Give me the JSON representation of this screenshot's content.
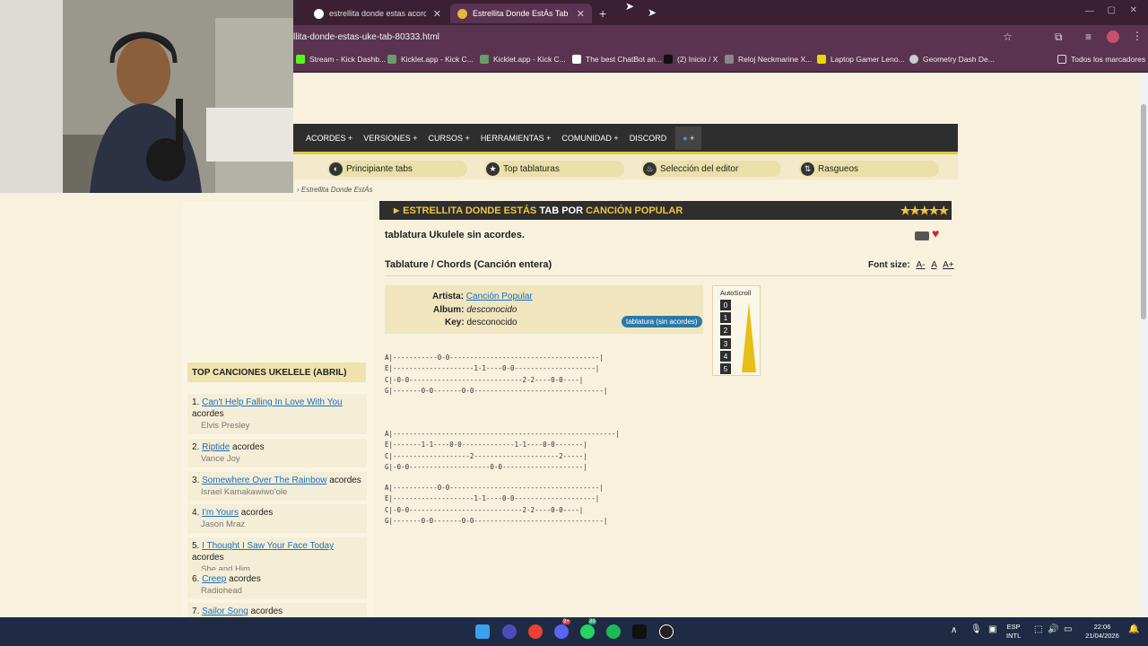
{
  "browser": {
    "tabs": [
      {
        "title": "estrellita donde estas acordes u",
        "active": false
      },
      {
        "title": "Estrellita Donde EstÁs Tab por C",
        "active": true
      }
    ],
    "new_tab": "+",
    "url": "llita-donde-estas-uke-tab-80333.html",
    "bookmarks": [
      "Stream - Kick Dashb...",
      "Kicklet.app - Kick C...",
      "Kicklet.app - Kick C...",
      "The best ChatBot an...",
      "(2) Inicio / X",
      "Reloj Neckmarine X...",
      "Laptop Gamer Leno...",
      "Geometry Dash De..."
    ],
    "all_bookmarks": "Todos los marcadores"
  },
  "site": {
    "nav": [
      "ACORDES +",
      "VERSIONES +",
      "CURSOS +",
      "HERRAMIENTAS +",
      "COMUNIDAD +",
      "DISCORD"
    ],
    "user_menu": "+",
    "subnav": [
      "Principiante tabs",
      "Top tablaturas",
      "Selección del editor",
      "Rasgueos"
    ],
    "breadcrumb": "Estrellita Donde EstÁs"
  },
  "sidebar": {
    "header": "TOP CANCIONES UKELELE (ABRIL)",
    "songs": [
      {
        "n": "1.",
        "title": "Can't Help Falling In Love With You",
        "suffix": "acordes",
        "artist": "Elvis Presley"
      },
      {
        "n": "2.",
        "title": "Riptide",
        "suffix": "acordes",
        "artist": "Vance Joy"
      },
      {
        "n": "3.",
        "title": "Somewhere Over The Rainbow",
        "suffix": "acordes",
        "artist": "Israel Kamakawiwo'ole"
      },
      {
        "n": "4.",
        "title": "I'm Yours",
        "suffix": "acordes",
        "artist": "Jason Mraz"
      },
      {
        "n": "5.",
        "title": "I Thought I Saw Your Face Today",
        "suffix": "acordes",
        "artist": "She and Him"
      },
      {
        "n": "6.",
        "title": "Creep",
        "suffix": "acordes",
        "artist": "Radiohead"
      },
      {
        "n": "7.",
        "title": "Sailor Song",
        "suffix": "acordes",
        "artist": ""
      }
    ]
  },
  "main": {
    "title_song": "ESTRELLITA DONDE ESTÁS",
    "title_mid": "TAB POR",
    "title_artist": "CANCIÓN POPULAR",
    "stars": "★★★★★",
    "subtitle": "tablatura Ukulele sin acordes.",
    "section": "Tablature / Chords (Canción entera)",
    "font_size_label": "Font size:",
    "font_buttons": [
      "A-",
      "A",
      "A+"
    ],
    "info": {
      "artist_label": "Artista:",
      "artist": "Canción Popular",
      "album_label": "Album:",
      "album": "desconocido",
      "key_label": "Key:",
      "key": "desconocido",
      "chip": "tablatura (sin acordes)"
    },
    "autoscroll": {
      "label": "AutoScroll",
      "levels": [
        "0",
        "1",
        "2",
        "3",
        "4",
        "5"
      ]
    },
    "tab_blocks": [
      "A|-----------0-0-------------------------------------|\nE|--------------------1-1----0-0--------------------|\nC|-0-0----------------------------2-2----0-0----|\nG|-------0-0-------0-0--------------------------------|",
      "A|-------------------------------------------------------|\nE|-------1-1----0-0-------------1-1----0-0-------|\nC|-------------------2---------------------2-----|\nG|-0-0--------------------0-0--------------------|",
      "A|-----------0-0-------------------------------------|\nE|--------------------1-1----0-0--------------------|\nC|-0-0----------------------------2-2----0-0----|\nG|-------0-0-------0-0--------------------------------|"
    ]
  },
  "taskbar": {
    "lang1": "ESP",
    "lang2": "INTL",
    "time": "22:06",
    "date": "21/04/2026",
    "badge_discord": "9+",
    "badge_whatsapp": "39"
  }
}
